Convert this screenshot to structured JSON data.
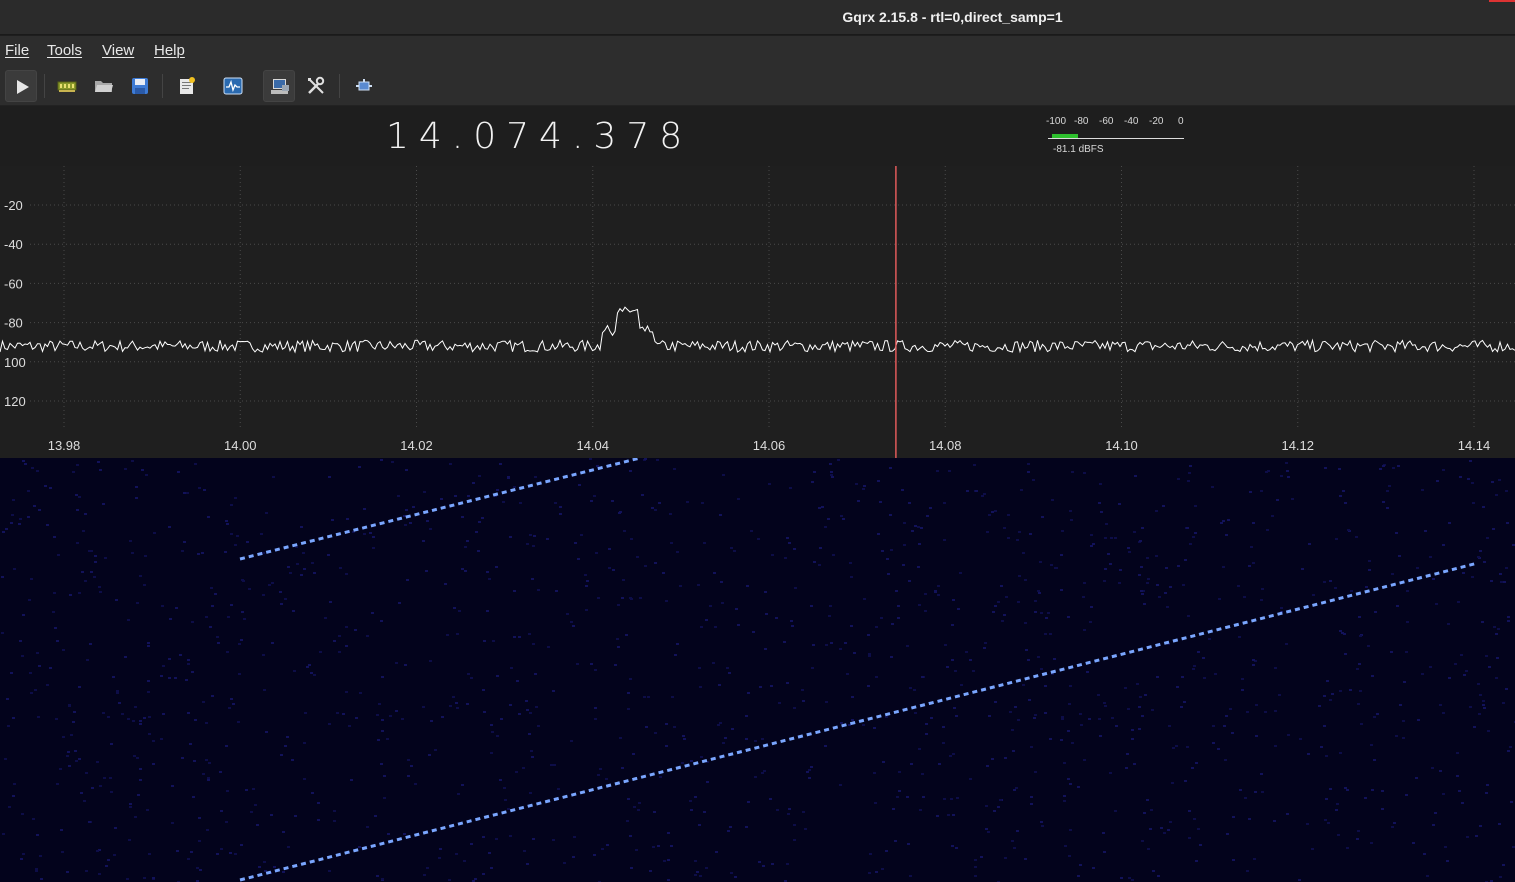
{
  "window": {
    "title": "Gqrx 2.15.8 - rtl=0,direct_samp=1"
  },
  "menu": {
    "items": [
      {
        "label": "File"
      },
      {
        "label": "Tools"
      },
      {
        "label": "View"
      },
      {
        "label": "Help"
      }
    ]
  },
  "toolbar": {
    "buttons": [
      {
        "name": "start-dsp-icon"
      },
      {
        "name": "io-devices-icon"
      },
      {
        "name": "load-settings-icon"
      },
      {
        "name": "save-settings-icon"
      },
      {
        "name": "bookmarks-icon"
      },
      {
        "name": "dx-cluster-icon"
      },
      {
        "name": "remote-control-icon"
      },
      {
        "name": "settings-icon"
      },
      {
        "name": "about-icon"
      }
    ]
  },
  "frequency": {
    "display": "14.074.378"
  },
  "smeter": {
    "scale": [
      "-100",
      "-80",
      "-60",
      "-40",
      "-20",
      "0"
    ],
    "readout": "-81.1 dBFS",
    "level_dbfs": -81.1
  },
  "spectrum": {
    "y_ticks": [
      "-20",
      "-40",
      "-60",
      "-80",
      "100",
      "120"
    ],
    "x_ticks": [
      "13.98",
      "14.00",
      "14.02",
      "14.04",
      "14.06",
      "14.08",
      "14.10",
      "14.12",
      "14.14"
    ],
    "center_marker_mhz": 14.0744,
    "noise_floor_db": -92,
    "peak": {
      "freq_mhz": 14.044,
      "db": -74
    },
    "colors": {
      "trace": "#ffffff",
      "grid": "#4a4a4a",
      "marker": "#e05a5a",
      "waterfall_bg": "#03031c",
      "waterfall_line": "#7aa6ff"
    }
  }
}
